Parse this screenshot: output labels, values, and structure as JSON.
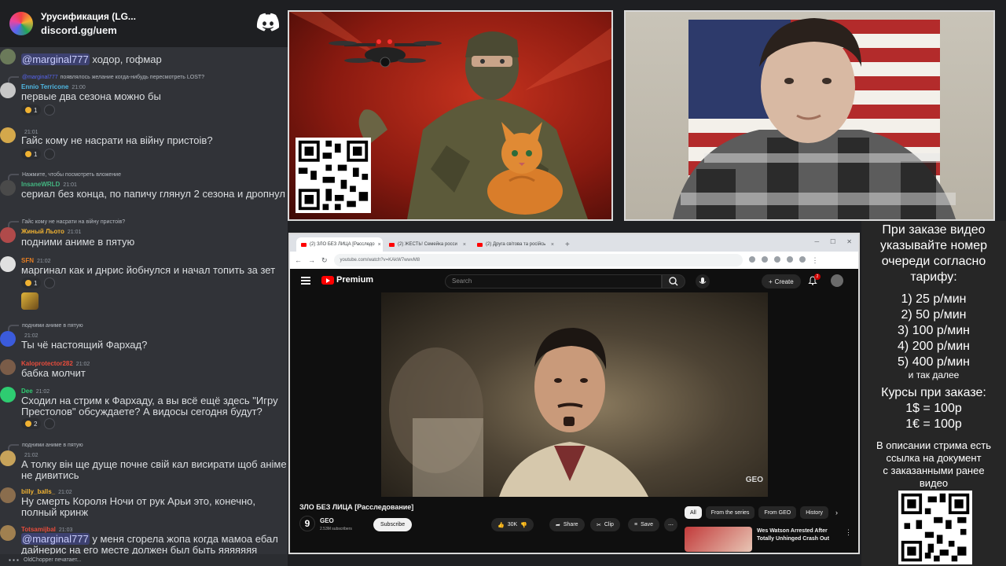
{
  "chat": {
    "server_name": "Урусификация (LG...",
    "invite": "discord.gg/uem",
    "messages": [
      {
        "username": "",
        "time": "",
        "mention": "@marginal777",
        "text": "ходор, гофмар"
      },
      {
        "reply_user": "@marginal777",
        "reply_text": "появлялось желание когда-нибудь пересмотреть LOST?",
        "username": "Ennio Terricone",
        "time": "21:00",
        "text": "первые два сезона можно бы",
        "reaction": "1"
      },
      {
        "username": "",
        "time": "21:01",
        "text": "Гайс кому не насрати на війну пристоів?",
        "reaction": "1"
      },
      {
        "reply_user": "",
        "reply_text": "Нажмите, чтобы посмотреть вложение",
        "username": "InsaneWRLD",
        "time": "21:01",
        "text": "сериал без конца, по папичу глянул 2 сезона и дропнул"
      },
      {
        "reply_user": "",
        "reply_text": "Гайс кому не насрати на війну пристоів?",
        "username": "Жиный Льото",
        "time": "21:01",
        "text": "подними аниме в пятую"
      },
      {
        "username": "SFN",
        "time": "21:02",
        "text": "маргинал как и днрис йобнулся и начал топить за зет",
        "reaction": "1"
      },
      {
        "reply_user": "",
        "reply_text": "подними аниме в пятую",
        "username": "",
        "time": "21:02",
        "text": "Ты чё настоящий Фархад?"
      },
      {
        "username": "Kaloprotector282",
        "time": "21:02",
        "text": "бабка молчит"
      },
      {
        "username": "Dee",
        "time": "21:02",
        "text": "Сходил на стрим к Фархаду, а вы всё ещё здесь \"Игру Престолов\" обсуждаете? А видосы сегодня будут?",
        "reaction": "2"
      },
      {
        "reply_user": "",
        "reply_text": "подними аниме в пятую",
        "username": "",
        "time": "21:02",
        "text": "А толку він ще дуще почне свій кал висирати щоб аніме не дивитись"
      },
      {
        "username": "billy_balls_",
        "time": "21:02",
        "text": "Ну смерть Короля Ночи от рук Арьи это, конечно, полный кринж"
      },
      {
        "username": "Totsamijbal",
        "time": "21:03",
        "mention": "@marginal777",
        "text": "у меня сгорела жопа когда мамоа ебал дайнерис на его месте должен был быть яяяяяяя"
      }
    ],
    "typing": "OldChopper печатает..."
  },
  "browser": {
    "tabs": [
      "(2) ЗЛО БЕЗ ЛИЦА [Расследо",
      "(2) ЖЕСТЬ! Семейка росси",
      "(2) Друга світова та російсь"
    ],
    "url": "youtube.com/watch?v=KAkW7wwvM8",
    "yt_brand": "Premium",
    "search_placeholder": "Search",
    "create_label": "Create",
    "notif_count": "2",
    "video_title": "ЗЛО БЕЗ ЛИЦА [Расследование]",
    "watermark": "GEO",
    "channel_name": "GEO",
    "channel_logo": "9",
    "channel_subs": "2.53M subscribers",
    "subscribe_label": "Subscribe",
    "likes": "30K",
    "share_label": "Share",
    "clip_label": "Clip",
    "save_label": "Save",
    "chips": [
      "All",
      "From the series",
      "From GEO",
      "History"
    ],
    "rec_title": "Wes Watson Arrested After Totally Unhinged Crash Out"
  },
  "info": {
    "lines": [
      "При заказе видео",
      "указывайте номер",
      "очереди согласно",
      "тарифу:"
    ],
    "tariffs": [
      "1) 25 р/мин",
      "2) 50 р/мин",
      "3) 100 р/мин",
      "4) 200 р/мин",
      "5) 400 р/мин"
    ],
    "tariffs_more": "и так далее",
    "rates_title": "Курсы при заказе:",
    "rates": [
      "1$ = 100р",
      "1€ = 100р"
    ],
    "desc": [
      "В описании стрима есть",
      "ссылка на документ",
      "с заказанными ранее",
      "видео"
    ]
  },
  "colors": {
    "discord_bg": "#313338",
    "mention": "#5865f2",
    "yt_red": "#ff0000",
    "info_bg": "#262626"
  }
}
